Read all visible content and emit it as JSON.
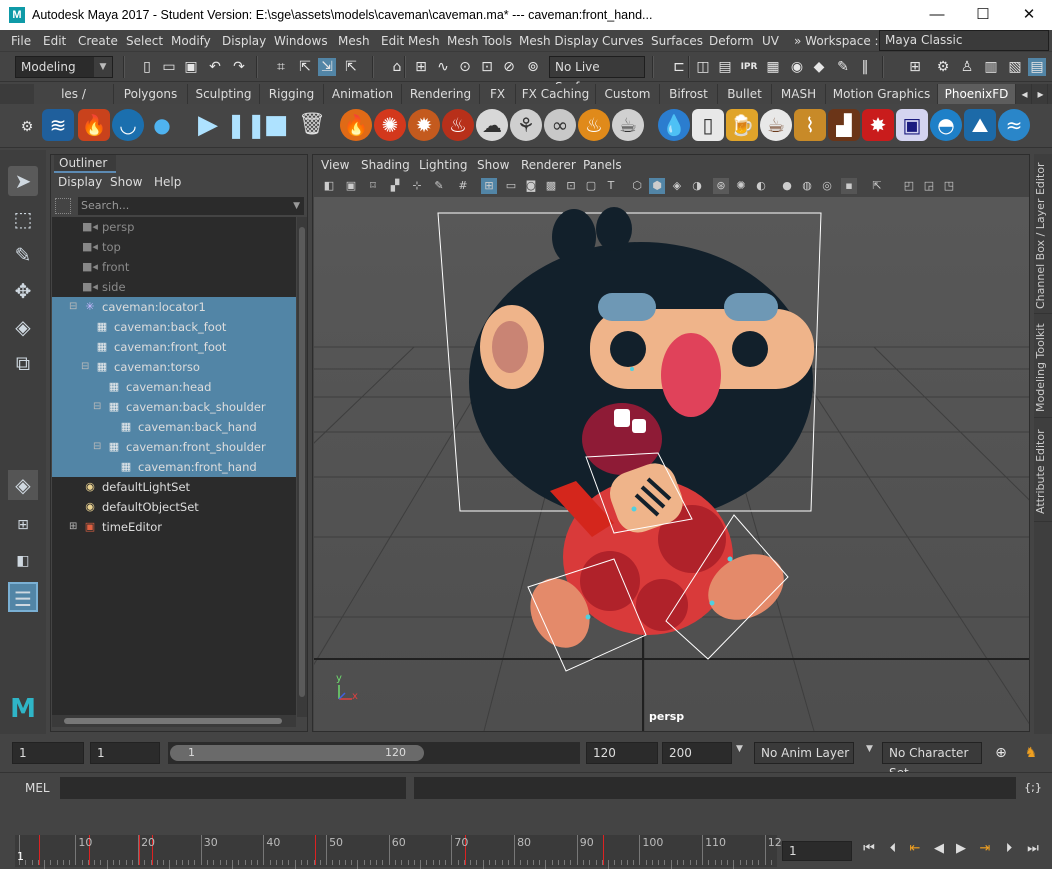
{
  "window": {
    "logo": "M",
    "title": "Autodesk Maya 2017 - Student Version: E:\\sge\\assets\\models\\caveman\\caveman.ma*   ---   caveman:front_hand...",
    "minimize": "—",
    "maximize": "☐",
    "close": "✕"
  },
  "menubar": [
    "File",
    "Edit",
    "Create",
    "Select",
    "Modify",
    "Display",
    "Windows",
    "Mesh",
    "Edit Mesh",
    "Mesh Tools",
    "Mesh Display",
    "Curves",
    "Surfaces",
    "Deform",
    "UV"
  ],
  "workspace": {
    "label": "» Workspace :",
    "value": "Maya Classic"
  },
  "status": {
    "menuset": "Modeling",
    "live_surface": "No Live Surface"
  },
  "shelf": {
    "tabs": [
      "les / Surfaces",
      "Polygons",
      "Sculpting",
      "Rigging",
      "Animation",
      "Rendering",
      "FX",
      "FX Caching",
      "Custom",
      "Bifrost",
      "Bullet",
      "MASH",
      "Motion Graphics",
      "PhoenixFD"
    ],
    "active_tab": "PhoenixFD"
  },
  "outliner": {
    "tab": "Outliner",
    "menus": [
      "Display",
      "Show",
      "Help"
    ],
    "search_placeholder": "Search...",
    "items": [
      {
        "label": "persp",
        "icon": "camera-icon",
        "depth": 0,
        "selected": false,
        "dim": true
      },
      {
        "label": "top",
        "icon": "camera-icon",
        "depth": 0,
        "selected": false,
        "dim": true
      },
      {
        "label": "front",
        "icon": "camera-icon",
        "depth": 0,
        "selected": false,
        "dim": true
      },
      {
        "label": "side",
        "icon": "camera-icon",
        "depth": 0,
        "selected": false,
        "dim": true
      },
      {
        "label": "caveman:locator1",
        "icon": "locator-icon",
        "depth": 0,
        "selected": true,
        "dim": false
      },
      {
        "label": "caveman:back_foot",
        "icon": "mesh-icon",
        "depth": 1,
        "selected": true,
        "dim": false
      },
      {
        "label": "caveman:front_foot",
        "icon": "mesh-icon",
        "depth": 1,
        "selected": true,
        "dim": false
      },
      {
        "label": "caveman:torso",
        "icon": "mesh-icon",
        "depth": 1,
        "selected": true,
        "dim": false
      },
      {
        "label": "caveman:head",
        "icon": "mesh-icon",
        "depth": 2,
        "selected": true,
        "dim": false
      },
      {
        "label": "caveman:back_shoulder",
        "icon": "mesh-icon",
        "depth": 2,
        "selected": true,
        "dim": false
      },
      {
        "label": "caveman:back_hand",
        "icon": "mesh-icon",
        "depth": 3,
        "selected": true,
        "dim": false
      },
      {
        "label": "caveman:front_shoulder",
        "icon": "mesh-icon",
        "depth": 2,
        "selected": true,
        "dim": false
      },
      {
        "label": "caveman:front_hand",
        "icon": "mesh-icon",
        "depth": 3,
        "selected": true,
        "dim": false
      },
      {
        "label": "defaultLightSet",
        "icon": "set-icon",
        "depth": 0,
        "selected": false,
        "dim": false
      },
      {
        "label": "defaultObjectSet",
        "icon": "set-icon",
        "depth": 0,
        "selected": false,
        "dim": false
      },
      {
        "label": "timeEditor",
        "icon": "time-editor-icon",
        "depth": 0,
        "selected": false,
        "dim": false
      }
    ]
  },
  "viewport": {
    "menus": [
      "View",
      "Shading",
      "Lighting",
      "Show",
      "Renderer",
      "Panels"
    ],
    "camera": "persp",
    "axis": {
      "y": "y",
      "x": "x"
    }
  },
  "right_tabs": [
    "Channel Box / Layer Editor",
    "Modeling Toolkit",
    "Attribute Editor"
  ],
  "range": {
    "start": "1",
    "current_start": "1",
    "slider_min": "1",
    "slider_max": "120",
    "end": "120",
    "end_max": "200",
    "anim_layer": "No Anim Layer",
    "character_set": "No Character Set"
  },
  "mel": {
    "label": "MEL"
  },
  "timeline": {
    "ticks": [
      "10",
      "20",
      "30",
      "40",
      "50",
      "60",
      "70",
      "80",
      "90",
      "100",
      "110",
      "12"
    ],
    "current_frame": "1",
    "frame_field": "1"
  },
  "colors": {
    "accent": "#5285a6",
    "maya_teal": "#0e9aa7"
  }
}
